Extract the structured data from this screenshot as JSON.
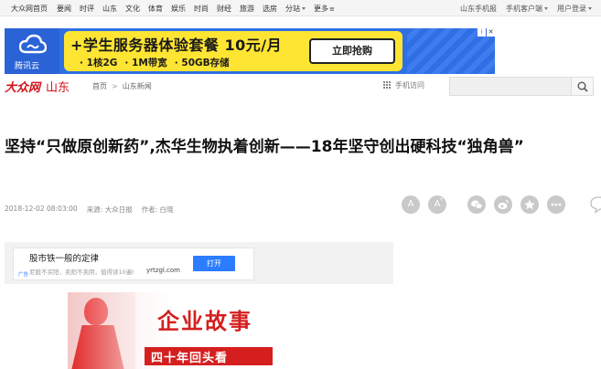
{
  "topnav": {
    "home": "大众网首页",
    "links": [
      "要闻",
      "时评",
      "山东",
      "文化",
      "体育",
      "娱乐",
      "时尚",
      "财经",
      "旅游",
      "选房",
      "分站",
      "更多"
    ],
    "right": [
      "山东手机报",
      "手机客户端",
      "用户登录"
    ]
  },
  "banner_ad": {
    "logo_text": "腾讯云",
    "headline": "+学生服务器体验套餐 10元/月",
    "specs": [
      "· 1核2G",
      "· 1M带宽",
      "· 50GB存储"
    ],
    "cta": "立即抢购",
    "close": "✕",
    "info": "i"
  },
  "header": {
    "logo_mark": "大众网",
    "region": "山东",
    "breadcrumb": [
      "首页",
      "山东新闻"
    ],
    "breadcrumb_sep": ">",
    "mobile_visit": "手机访问",
    "search_placeholder": ""
  },
  "article": {
    "title": "坚持“只做原创新药”,杰华生物执着创新——18年坚守创出硬科技“独角兽”",
    "date": "2018-12-02 08:03:00",
    "source": "来源: 大众日报",
    "author": "作者: 白晓"
  },
  "tools": {
    "font_small": "A",
    "font_large": "A",
    "font_small_sign": "-",
    "font_large_sign": "+"
  },
  "inline_ad": {
    "title": "股市铁一般的定律",
    "desc": "尼股不买阳，卖阳不卖阴，值得读10遍!",
    "domain": "yrtzgl.com",
    "open": "打开",
    "mark": "广告"
  },
  "feature_image": {
    "main": "企业故事",
    "sub": "四十年回头看"
  },
  "colors": {
    "brand_red": "#d1141b",
    "ad_blue": "#2f6fe3",
    "ad_yellow": "#ffe533",
    "open_blue": "#2b7cff"
  }
}
